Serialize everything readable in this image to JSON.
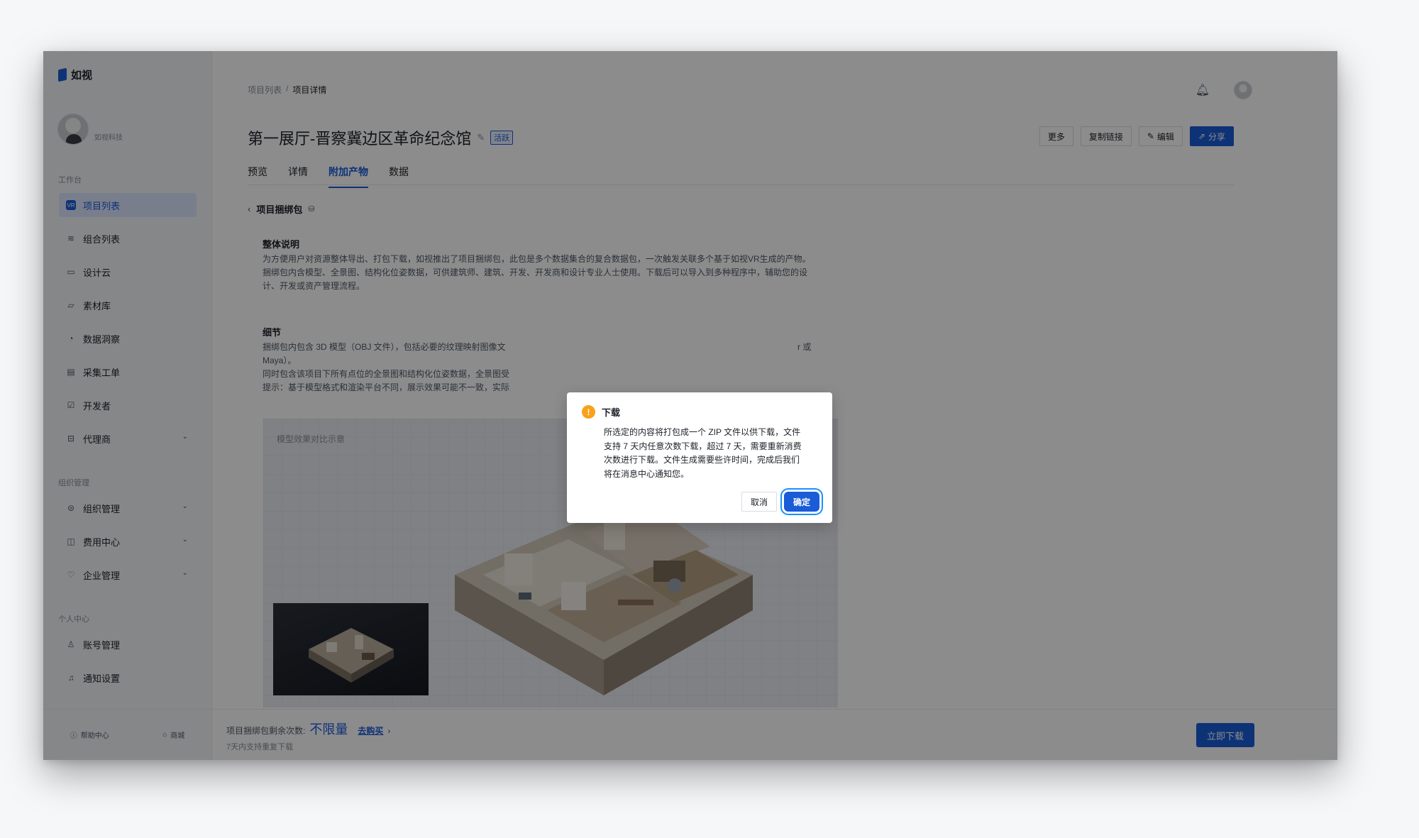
{
  "app": {
    "name": "如视"
  },
  "profile": {
    "name": "如视科技"
  },
  "sidebar": {
    "sections": {
      "workspace": "工作台",
      "org": "组织管理",
      "personal": "个人中心"
    },
    "items": [
      {
        "label": "项目列表",
        "icon": "vr-icon",
        "active": true
      },
      {
        "label": "组合列表",
        "icon": "layers-icon"
      },
      {
        "label": "设计云",
        "icon": "monitor-icon"
      },
      {
        "label": "素材库",
        "icon": "folder-icon"
      },
      {
        "label": "数据洞察",
        "icon": "pie-chart-icon"
      },
      {
        "label": "采集工单",
        "icon": "document-icon"
      },
      {
        "label": "开发者",
        "icon": "code-icon"
      },
      {
        "label": "代理商",
        "icon": "briefcase-icon"
      },
      {
        "label": "组织管理",
        "icon": "org-icon"
      },
      {
        "label": "费用中心",
        "icon": "wallet-icon"
      },
      {
        "label": "企业管理",
        "icon": "shield-icon"
      },
      {
        "label": "账号管理",
        "icon": "user-icon"
      },
      {
        "label": "通知设置",
        "icon": "bell-icon"
      }
    ],
    "footer": {
      "help": "帮助中心",
      "store": "商城"
    }
  },
  "breadcrumb": {
    "parent": "项目列表",
    "separator": "/",
    "current": "项目详情"
  },
  "project": {
    "title": "第一展厅-晋察冀边区革命纪念馆",
    "status": "活跃"
  },
  "actions": {
    "more": "更多",
    "copy_link": "复制链接",
    "edit": "编辑",
    "share": "分享"
  },
  "tabs": [
    "预览",
    "详情",
    "附加产物",
    "数据"
  ],
  "bundle": {
    "back_title": "项目捆绑包",
    "overview_title": "整体说明",
    "overview_lines": [
      "为方便用户对资源整体导出、打包下载，如视推出了项目捆绑包，此包是多个数据集合的复合数据包，一次触发关联多个基于如视VR生成的产物。",
      "捆绑包内含模型、全景图、结构化位姿数据，可供建筑师、建筑、开发、开发商和设计专业人士使用。下载后可以导入到多种程序中，辅助您的设",
      "计、开发或资产管理流程。"
    ],
    "detail_title": "细节",
    "detail_lines": [
      "捆绑包内包含 3D 模型（OBJ 文件），包括必要的纹理映射图像文",
      "Maya）。",
      "同时包含该项目下所有点位的全景图和结构化位姿数据，全景图受",
      "提示：基于模型格式和渲染平台不同，展示效果可能不一致，实际"
    ],
    "detail_tail": "r 或",
    "preview_label": "模型效果对比示意"
  },
  "bottom": {
    "remain_label": "项目捆绑包剩余次数:",
    "remain_value": "不限量",
    "buy": "去购买",
    "buy_arrow": "›",
    "sub": "7天内支持重复下载",
    "download": "立即下载"
  },
  "dialog": {
    "title": "下载",
    "body_lines": [
      "所选定的内容将打包成一个 ZIP 文件以供下载，文件",
      "支持 7 天内任意次数下载，超过 7 天，需要重新消费",
      "次数进行下载。文件生成需要些许时间，完成后我们",
      "将在消息中心通知您。"
    ],
    "cancel": "取消",
    "confirm": "确定"
  },
  "colors": {
    "primary": "#1a5bd8",
    "warning": "#f7a21b",
    "overlay": "rgba(0,0,0,0.45)"
  }
}
